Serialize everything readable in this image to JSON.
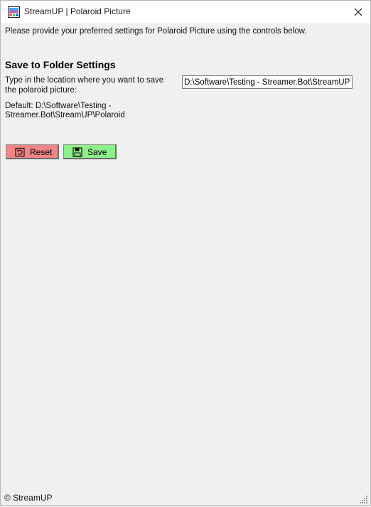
{
  "window": {
    "title": "StreamUP | Polaroid Picture",
    "app_icon": "streamup-app-icon",
    "close_icon": "close-icon"
  },
  "intro_text": "Please provide your preferred settings for Polaroid Picture using the controls below.",
  "save_folder": {
    "section_title": "Save to Folder Settings",
    "field_label": "Type in the location where you want to save the polaroid picture:",
    "path_value": "D:\\Software\\Testing - Streamer.Bot\\StreamUP\\Polaroid",
    "default_text": "Default: D:\\Software\\Testing - Streamer.Bot\\StreamUP\\Polaroid"
  },
  "buttons": {
    "reset_label": "Reset",
    "reset_icon": "reset-icon",
    "reset_color": "#f28585",
    "save_label": "Save",
    "save_icon": "floppy-disk-icon",
    "save_color": "#8ef08a"
  },
  "status": {
    "text": "© StreamUP"
  }
}
